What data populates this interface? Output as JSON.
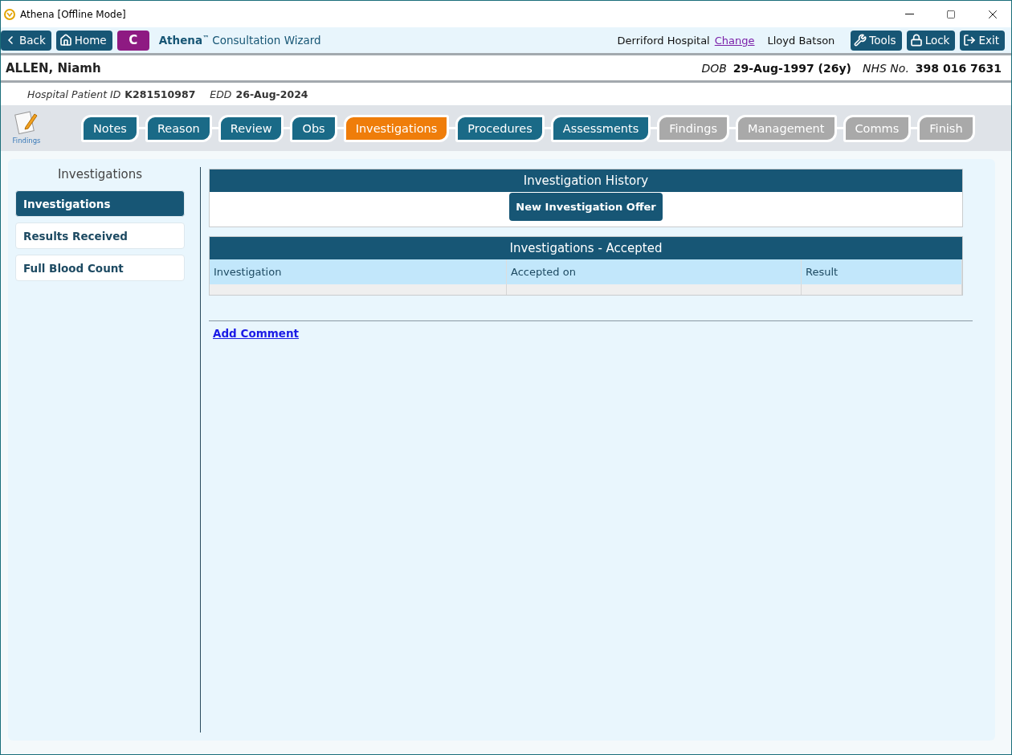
{
  "window": {
    "title": "Athena [Offline Mode]"
  },
  "toolbar": {
    "left_buttons": [
      {
        "label": "Back",
        "kind": "back"
      },
      {
        "label": "Home",
        "kind": "home"
      }
    ],
    "badge": "C",
    "app_name": "Athena",
    "app_mark": "™",
    "app_subtitle": "Consultation Wizard",
    "hospital": "Derriford Hospital",
    "change_link": "Change",
    "user": "Lloyd Batson",
    "right_buttons": [
      {
        "label": "Tools",
        "kind": "tools"
      },
      {
        "label": "Lock",
        "kind": "lock"
      },
      {
        "label": "Exit",
        "kind": "exit"
      }
    ]
  },
  "patient": {
    "name": "ALLEN, Niamh",
    "dob_label": "DOB",
    "dob": "29-Aug-1997 (26y)",
    "nhs_label": "NHS No.",
    "nhs": "398 016 7631",
    "id_label": "Hospital Patient ID",
    "id": "K281510987",
    "edd_label": "EDD",
    "edd": "26-Aug-2024"
  },
  "findings_shortcut": "Findings",
  "steps": [
    {
      "label": "Notes",
      "selected": false,
      "disabled": false
    },
    {
      "label": "Reason",
      "selected": false,
      "disabled": false
    },
    {
      "label": "Review",
      "selected": false,
      "disabled": false
    },
    {
      "label": "Obs",
      "selected": false,
      "disabled": false
    },
    {
      "label": "Investigations",
      "selected": true,
      "disabled": false
    },
    {
      "label": "Procedures",
      "selected": false,
      "disabled": false
    },
    {
      "label": "Assessments",
      "selected": false,
      "disabled": false
    },
    {
      "label": "Findings",
      "selected": false,
      "disabled": true
    },
    {
      "label": "Management",
      "selected": false,
      "disabled": true
    },
    {
      "label": "Comms",
      "selected": false,
      "disabled": true
    },
    {
      "label": "Finish",
      "selected": false,
      "disabled": true
    }
  ],
  "sidebar": {
    "title": "Investigations",
    "items": [
      {
        "label": "Investigations",
        "selected": true
      },
      {
        "label": "Results Received",
        "selected": false
      },
      {
        "label": "Full Blood Count",
        "selected": false
      }
    ]
  },
  "history": {
    "title": "Investigation History",
    "button": "New Investigation Offer"
  },
  "accepted": {
    "title": "Investigations - Accepted",
    "columns": [
      "Investigation",
      "Accepted on",
      "Result"
    ]
  },
  "add_comment": "Add Comment"
}
